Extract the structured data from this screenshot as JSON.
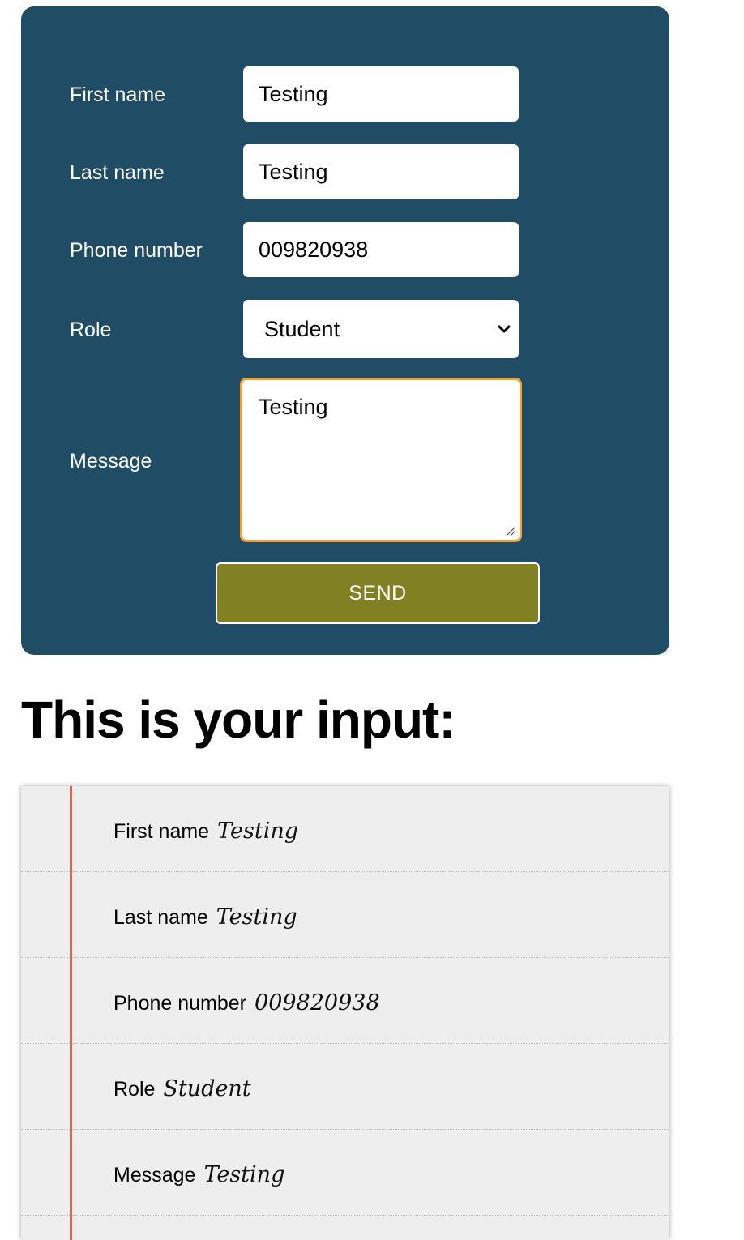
{
  "form": {
    "fields": [
      {
        "label": "First name",
        "value": "Testing"
      },
      {
        "label": "Last name",
        "value": "Testing"
      },
      {
        "label": "Phone number",
        "value": "009820938"
      }
    ],
    "role": {
      "label": "Role",
      "selected": "Student"
    },
    "message": {
      "label": "Message",
      "value": "Testing"
    },
    "send_label": "SEND"
  },
  "output": {
    "heading": "This is your input:",
    "rows": [
      {
        "label": "First name",
        "value": "Testing"
      },
      {
        "label": "Last name",
        "value": "Testing"
      },
      {
        "label": "Phone number",
        "value": "009820938"
      },
      {
        "label": "Role",
        "value": "Student"
      },
      {
        "label": "Message",
        "value": "Testing"
      }
    ]
  },
  "colors": {
    "card_bg": "#214c66",
    "button_bg": "#818124",
    "focus_border": "#f0a238",
    "margin_line": "#e8643c",
    "paper_bg": "#eeeeee"
  }
}
